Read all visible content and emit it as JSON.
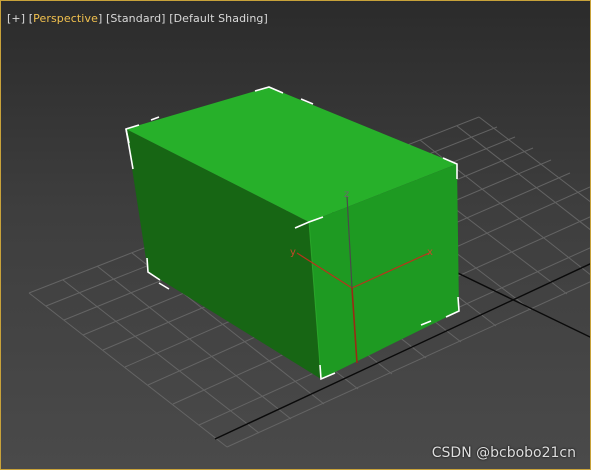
{
  "viewport": {
    "menu_plus": "[+]",
    "view_open": "[",
    "view_name": "Perspective",
    "view_close": "]",
    "shading_mode": "[Standard]",
    "shading_style": "[Default Shading]",
    "label_color_active": "#f2c14e",
    "border_color": "#c8a23a"
  },
  "scene": {
    "object": "box",
    "object_colors": {
      "top": "#27b02a",
      "front": "#1e9a22",
      "left": "#176614"
    },
    "gizmo": {
      "x_label": "x",
      "y_label": "y",
      "z_label": "z"
    }
  },
  "watermark": "CSDN @bcbobo21cn"
}
